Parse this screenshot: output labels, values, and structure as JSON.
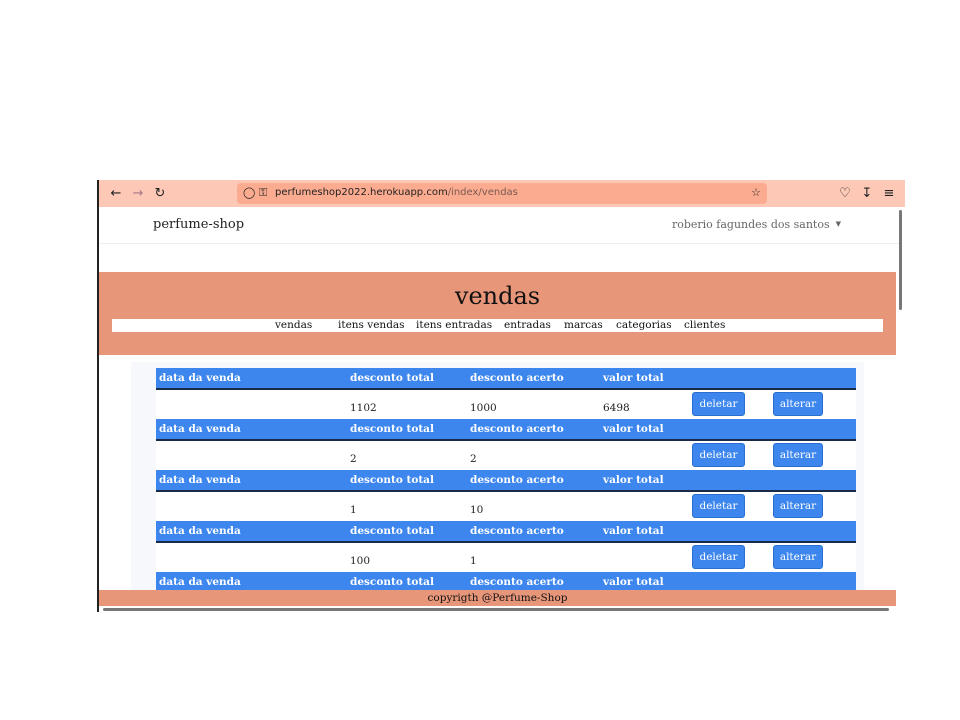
{
  "browser": {
    "url_host": "perfumeshop2022.herokuapp.com",
    "url_path": "/index/vendas"
  },
  "navbar": {
    "brand": "perfume-shop",
    "user": "roberio fagundes dos santos"
  },
  "hero": {
    "title": "vendas",
    "menu": [
      "vendas",
      "itens vendas",
      "itens entradas",
      "entradas",
      "marcas",
      "categorias",
      "clientes"
    ]
  },
  "table": {
    "headers": [
      "data da venda",
      "desconto total",
      "desconto acerto",
      "valor total"
    ],
    "rows": [
      {
        "data": "",
        "desconto_total": "1102",
        "desconto_acerto": "1000",
        "valor_total": "6498"
      },
      {
        "data": "",
        "desconto_total": "2",
        "desconto_acerto": "2",
        "valor_total": ""
      },
      {
        "data": "",
        "desconto_total": "1",
        "desconto_acerto": "10",
        "valor_total": ""
      },
      {
        "data": "",
        "desconto_total": "100",
        "desconto_acerto": "1",
        "valor_total": ""
      }
    ],
    "delete_label": "deletar",
    "edit_label": "alterar"
  },
  "footer": {
    "text": "copyrigth @Perfume-Shop"
  }
}
